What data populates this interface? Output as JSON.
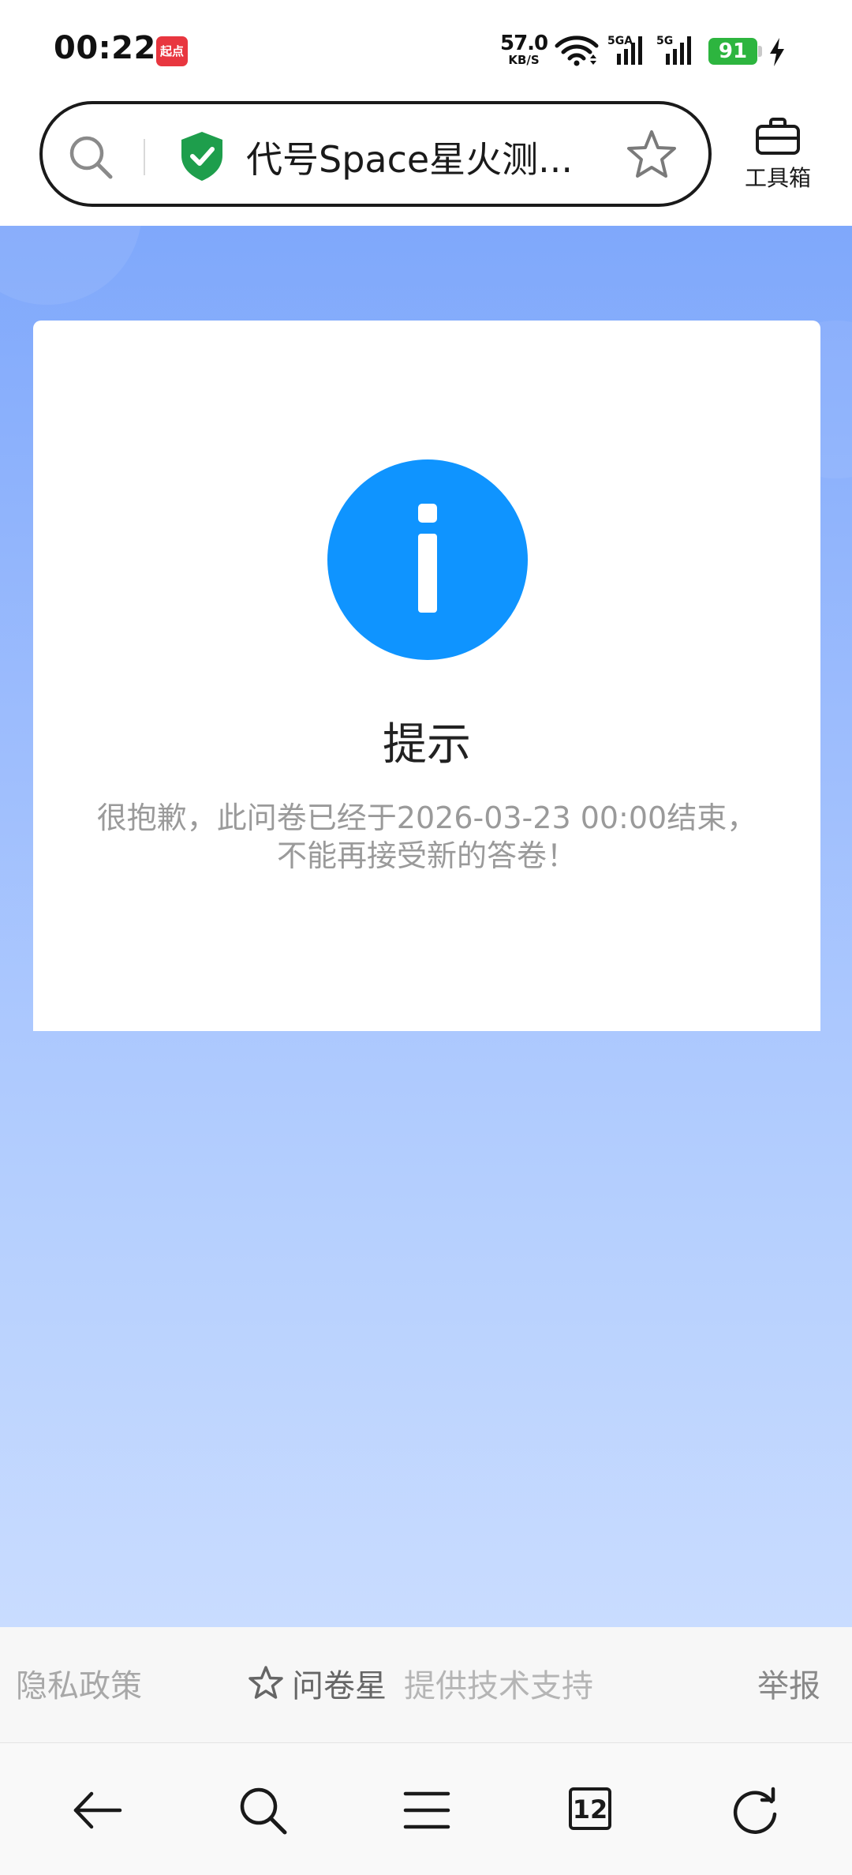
{
  "status_bar": {
    "time": "00:22",
    "notification_app": "起点",
    "net_speed_value": "57.0",
    "net_speed_unit": "KB/S",
    "sim1_label": "5GA",
    "sim2_label": "5G",
    "battery": "91",
    "icons": [
      "wifi-icon",
      "signal-icon",
      "signal-icon",
      "battery-icon",
      "charging-bolt-icon"
    ]
  },
  "address_bar": {
    "title": "代号Space星火测...",
    "icons": [
      "search-icon",
      "secure-shield-icon",
      "star-icon"
    ],
    "toolbox_label": "工具箱"
  },
  "notice": {
    "icon": "info-icon",
    "title": "提示",
    "message": "很抱歉，此问卷已经于2026-03-23 00:00结束，不能再接受新的答卷！",
    "accent_color": "#0f94ff"
  },
  "footer": {
    "privacy": "隐私政策",
    "brand": "问卷星",
    "support": "提供技术支持",
    "report": "举报"
  },
  "nav": {
    "tab_count": "12",
    "icons": [
      "back-arrow-icon",
      "search-icon",
      "menu-icon",
      "tabs-icon",
      "refresh-icon"
    ]
  }
}
